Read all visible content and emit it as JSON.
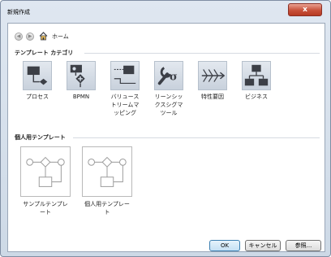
{
  "window": {
    "title": "新規作成",
    "close_label": "x"
  },
  "nav": {
    "back_glyph": "◀",
    "forward_glyph": "▶",
    "home_label": "ホーム"
  },
  "template_category": {
    "heading": "テンプレート カテゴリ",
    "items": [
      {
        "label": "プロセス",
        "icon": "process-flow-icon"
      },
      {
        "label": "BPMN",
        "icon": "bpmn-icon"
      },
      {
        "label": "バリュース\nトリームマ\nッピング",
        "icon": "value-stream-mapping-icon"
      },
      {
        "label": "リーンシッ\nクスシグマ\nツール",
        "icon": "lean-six-sigma-icon"
      },
      {
        "label": "特性要因",
        "icon": "fishbone-icon"
      },
      {
        "label": "ビジネス",
        "icon": "org-chart-icon"
      }
    ]
  },
  "personal_templates": {
    "heading": "個人用テンプレート",
    "items": [
      {
        "label": "サンプルテンプレ\nート",
        "icon": "diagram-template-icon"
      },
      {
        "label": "個人用テンプレー\nト",
        "icon": "diagram-template-icon"
      }
    ]
  },
  "buttons": {
    "ok": "OK",
    "cancel": "キャンセル",
    "browse": "参照..."
  },
  "colors": {
    "icon_dark": "#3c3f46",
    "tile_bg": "#d3dbe5",
    "accent_blue": "#3c7fb1"
  }
}
